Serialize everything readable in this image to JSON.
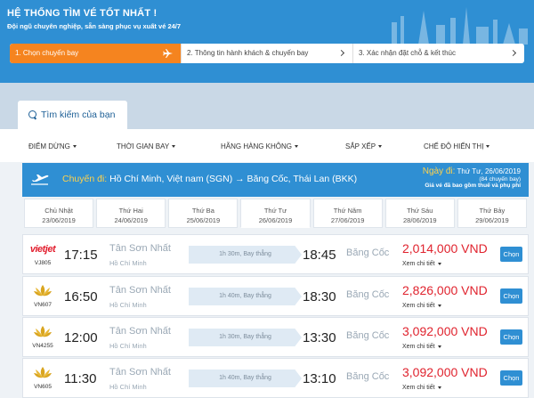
{
  "header": {
    "title": "HỆ THỐNG TÌM VÉ TỐT NHẤT !",
    "subtitle": "Đội ngũ chuyên nghiệp, sẵn sàng phục vụ xuất vé 24/7"
  },
  "steps": [
    {
      "label": "1. Chọn chuyến bay",
      "icon": "airplane-icon"
    },
    {
      "label": "2. Thông tin hành khách & chuyến bay",
      "icon": "chevron-right-icon"
    },
    {
      "label": "3. Xác nhận đặt chỗ & kết thúc",
      "icon": "chevron-right-icon"
    }
  ],
  "search_tab": {
    "label": "Tìm kiếm của bạn",
    "icon": "search-icon"
  },
  "filters": [
    "ĐIỂM DỪNG",
    "THỜI GIAN BAY",
    "HÃNG HÀNG KHÔNG",
    "SẮP XẾP",
    "CHẾ ĐỘ HIỂN THỊ"
  ],
  "route": {
    "label": "Chuyến đi:",
    "text": "Hồ Chí Minh, Việt nam (SGN) → Băng Cốc, Thái Lan (BKK)",
    "date_label": "Ngày đi:",
    "date": "Thứ Tư, 26/06/2019",
    "count": "(84 chuyến bay)",
    "note": "Giá vé đã bao gồm thuế và phụ phí"
  },
  "dates": [
    {
      "day": "Chủ Nhật",
      "date": "23/06/2019"
    },
    {
      "day": "Thứ Hai",
      "date": "24/06/2019"
    },
    {
      "day": "Thứ Ba",
      "date": "25/06/2019"
    },
    {
      "day": "Thứ Tư",
      "date": "26/06/2019"
    },
    {
      "day": "Thứ Năm",
      "date": "27/06/2019"
    },
    {
      "day": "Thứ Sáu",
      "date": "28/06/2019"
    },
    {
      "day": "Thứ Bảy",
      "date": "29/06/2019"
    }
  ],
  "flights": [
    {
      "airline_logo_text": "vietjet",
      "code": "VJ805",
      "dep_time": "17:15",
      "dep_airport": "Tân Sơn Nhất",
      "dep_city": "Hồ Chí Minh",
      "duration": "1h 30m, Bay thẳng",
      "arr_time": "18:45",
      "arr_airport": "Băng Cốc",
      "price": "2,014,000 VND",
      "detail": "Xem chi tiết",
      "select": "Chọn"
    },
    {
      "airline_logo_text": "",
      "code": "VN607",
      "dep_time": "16:50",
      "dep_airport": "Tân Sơn Nhất",
      "dep_city": "Hồ Chí Minh",
      "duration": "1h 40m, Bay thẳng",
      "arr_time": "18:30",
      "arr_airport": "Băng Cốc",
      "price": "2,826,000 VND",
      "detail": "Xem chi tiết",
      "select": "Chọn"
    },
    {
      "airline_logo_text": "",
      "code": "VN4255",
      "dep_time": "12:00",
      "dep_airport": "Tân Sơn Nhất",
      "dep_city": "Hồ Chí Minh",
      "duration": "1h 30m, Bay thẳng",
      "arr_time": "13:30",
      "arr_airport": "Băng Cốc",
      "price": "3,092,000 VND",
      "detail": "Xem chi tiết",
      "select": "Chọn"
    },
    {
      "airline_logo_text": "",
      "code": "VN605",
      "dep_time": "11:30",
      "dep_airport": "Tân Sơn Nhất",
      "dep_city": "Hồ Chí Minh",
      "duration": "1h 40m, Bay thẳng",
      "arr_time": "13:10",
      "arr_airport": "Băng Cốc",
      "price": "3,092,000 VND",
      "detail": "Xem chi tiết",
      "select": "Chọn"
    }
  ],
  "colors": {
    "primary": "#2f8fd3",
    "accent": "#f5841f",
    "price": "#e0232e",
    "highlight": "#ffd24c"
  }
}
